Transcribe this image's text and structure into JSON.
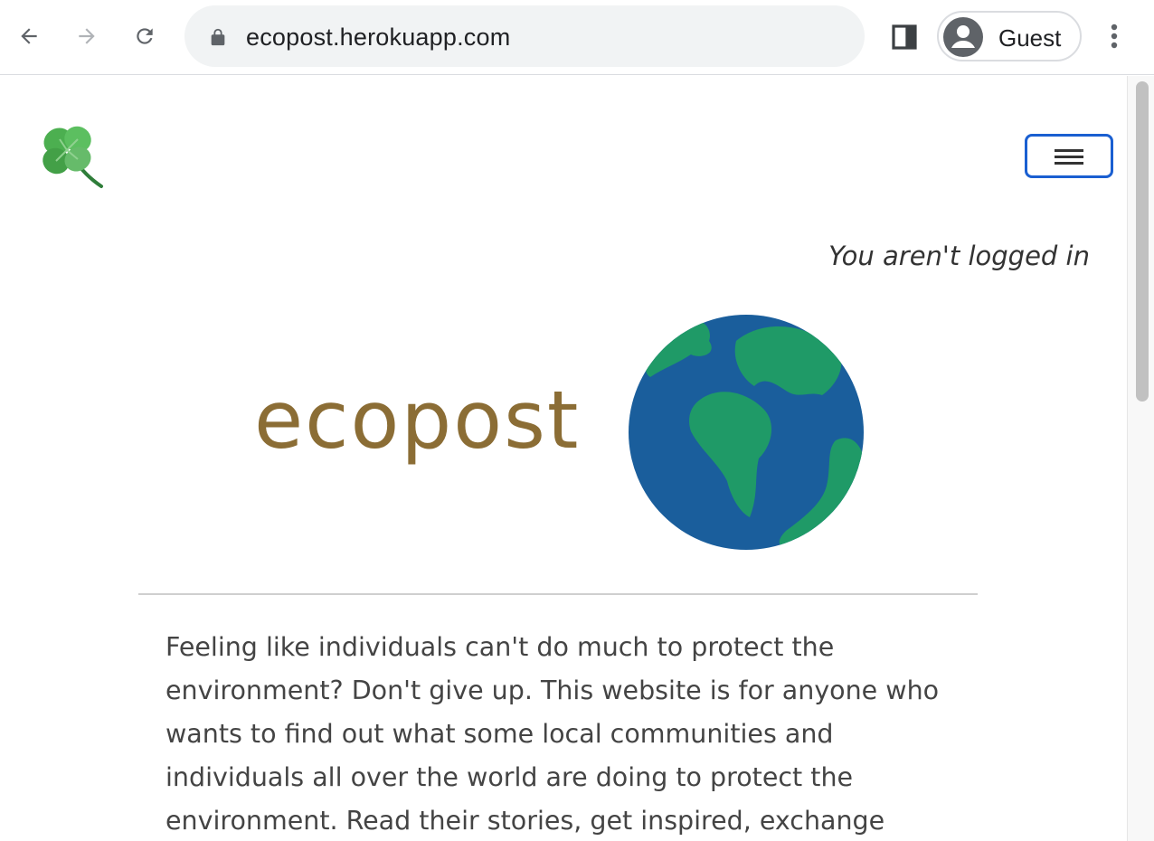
{
  "browser": {
    "url": "ecopost.herokuapp.com",
    "profile_name": "Guest",
    "icons": {
      "back": "back-arrow-icon",
      "forward": "forward-arrow-icon",
      "reload": "reload-icon",
      "lock": "lock-icon",
      "side_panel": "side-panel-icon",
      "avatar": "avatar-icon",
      "menu": "kebab-menu-icon"
    }
  },
  "site": {
    "logo_icon": "clover-icon",
    "menu_icon": "hamburger-icon",
    "login_status": "You aren't logged in",
    "brand_name": "ecopost",
    "globe_icon": "globe-icon",
    "intro_text": "Feeling like individuals can't do much to protect the environment? Don't give up. This website is for anyone who wants to find out what some local communities and individuals all over the world are doing to protect the environment. Read their stories, get inspired, exchange",
    "colors": {
      "brand": "#8b6d35",
      "toggler_border": "#1a5fd1",
      "ocean": "#1a5e9c",
      "land": "#1f9a67"
    }
  }
}
